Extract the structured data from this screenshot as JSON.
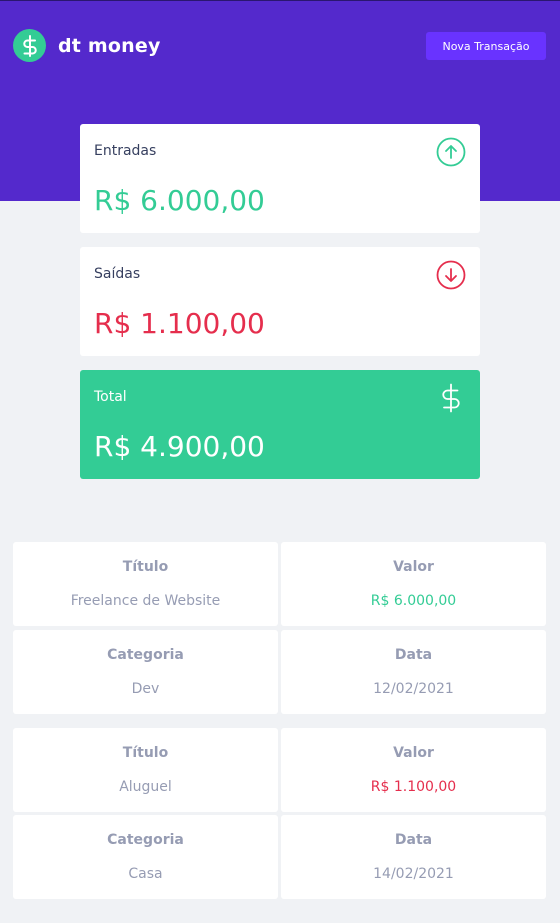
{
  "app": {
    "name": "dt money",
    "new_transaction_label": "Nova Transação"
  },
  "summary": {
    "income": {
      "label": "Entradas",
      "value": "R$ 6.000,00",
      "icon": "arrow-up-circle-icon",
      "color": "#33cc95"
    },
    "outcome": {
      "label": "Saídas",
      "value": "R$ 1.100,00",
      "icon": "arrow-down-circle-icon",
      "color": "#e52e4d"
    },
    "total": {
      "label": "Total",
      "value": "R$ 4.900,00",
      "icon": "dollar-icon",
      "color": "#33cc95"
    }
  },
  "transactions": [
    {
      "title_header": "Título",
      "title": "Freelance de Website",
      "amount_header": "Valor",
      "amount": "R$ 6.000,00",
      "type": "deposit",
      "category_header": "Categoria",
      "category": "Dev",
      "date_header": "Data",
      "date": "12/02/2021"
    },
    {
      "title_header": "Título",
      "title": "Aluguel",
      "amount_header": "Valor",
      "amount": "R$ 1.100,00",
      "type": "withdraw",
      "category_header": "Categoria",
      "category": "Casa",
      "date_header": "Data",
      "date": "14/02/2021"
    }
  ]
}
